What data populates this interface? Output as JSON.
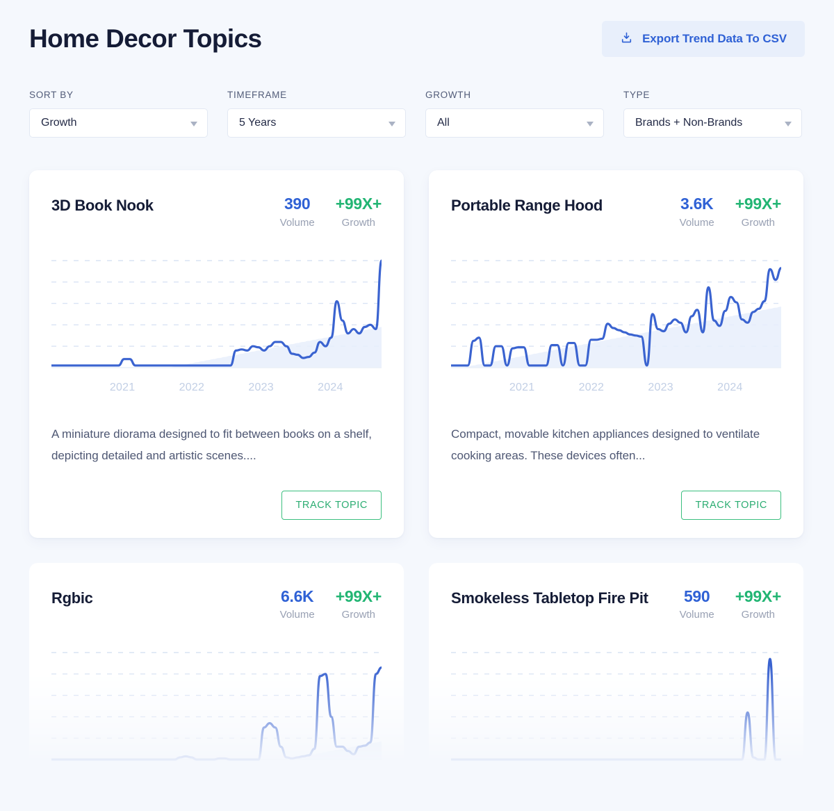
{
  "header": {
    "title": "Home Decor Topics",
    "export_label": "Export Trend Data To CSV",
    "export_icon": "download-icon"
  },
  "filters": [
    {
      "label": "SORT BY",
      "value": "Growth"
    },
    {
      "label": "TIMEFRAME",
      "value": "5 Years"
    },
    {
      "label": "GROWTH",
      "value": "All"
    },
    {
      "label": "TYPE",
      "value": "Brands + Non-Brands"
    }
  ],
  "colors": {
    "page_bg": "#f5f8fd",
    "card_bg": "#ffffff",
    "title": "#151c36",
    "volume": "#2f61d5",
    "growth": "#22b573",
    "line": "#3a63d0",
    "area": "#e8effb",
    "gridline": "#d9e3f4",
    "axis_label": "#c2cfe5",
    "track_border": "#3bbf7f"
  },
  "labels": {
    "volume_caption": "Volume",
    "growth_caption": "Growth",
    "track_label": "TRACK TOPIC"
  },
  "cards": [
    {
      "name": "3D Book Nook",
      "volume": "390",
      "growth": "+99X+",
      "description": "A miniature diorama designed to fit between books on a shelf, depicting detailed and artistic scenes....",
      "truncated": false,
      "chart_data": {
        "type": "line",
        "title": "3D Book Nook search volume trend",
        "xlabel": "",
        "ylabel": "",
        "grid": true,
        "gridlines": 5,
        "xticks": [
          "2021",
          "2022",
          "2023",
          "2024"
        ],
        "xtick_pos": [
          0.215,
          0.425,
          0.635,
          0.845
        ],
        "ylim": [
          0,
          100
        ],
        "x": [
          0,
          1,
          2,
          3,
          4,
          5,
          6,
          7,
          8,
          9,
          10,
          11,
          12,
          13,
          14,
          15,
          16,
          17,
          18,
          19,
          20,
          21,
          22,
          23,
          24,
          25,
          26,
          27,
          28,
          29,
          30,
          31,
          32,
          33,
          34,
          35,
          36,
          37,
          38,
          39,
          40,
          41,
          42,
          43,
          44,
          45,
          46,
          47,
          48,
          49,
          50,
          51,
          52,
          53,
          54,
          55,
          56,
          57,
          58,
          59
        ],
        "values": [
          2,
          2,
          2,
          2,
          2,
          2,
          2,
          2,
          2,
          2,
          2,
          2,
          2,
          8,
          8,
          2,
          2,
          2,
          2,
          2,
          2,
          2,
          2,
          2,
          2,
          2,
          2,
          2,
          2,
          2,
          2,
          2,
          2,
          16,
          17,
          16,
          20,
          19,
          16,
          20,
          24,
          24,
          20,
          13,
          12,
          9,
          10,
          14,
          24,
          20,
          28,
          62,
          44,
          32,
          36,
          32,
          38,
          40,
          36,
          100
        ],
        "area_baseline": [
          0,
          0,
          0,
          0,
          0,
          0,
          0,
          0,
          0,
          0,
          0,
          0,
          0,
          0,
          0,
          0,
          0,
          0,
          0,
          0,
          0,
          0,
          1,
          2,
          3,
          4,
          5,
          6,
          7,
          8,
          9,
          10,
          11,
          12,
          13,
          14,
          15,
          16,
          17,
          18,
          19,
          20,
          21,
          22,
          23,
          24,
          25,
          26,
          27,
          28,
          29,
          30,
          31,
          32,
          33,
          34,
          35,
          36,
          37,
          38
        ]
      }
    },
    {
      "name": "Portable Range Hood",
      "volume": "3.6K",
      "growth": "+99X+",
      "description": "Compact, movable kitchen appliances designed to ventilate cooking areas. These devices often...",
      "truncated": true,
      "chart_data": {
        "type": "line",
        "title": "Portable Range Hood search volume trend",
        "xlabel": "",
        "ylabel": "",
        "grid": true,
        "gridlines": 5,
        "xticks": [
          "2021",
          "2022",
          "2023",
          "2024"
        ],
        "xtick_pos": [
          0.215,
          0.425,
          0.635,
          0.845
        ],
        "ylim": [
          0,
          100
        ],
        "x": [
          0,
          1,
          2,
          3,
          4,
          5,
          6,
          7,
          8,
          9,
          10,
          11,
          12,
          13,
          14,
          15,
          16,
          17,
          18,
          19,
          20,
          21,
          22,
          23,
          24,
          25,
          26,
          27,
          28,
          29,
          30,
          31,
          32,
          33,
          34,
          35,
          36,
          37,
          38,
          39,
          40,
          41,
          42,
          43,
          44,
          45,
          46,
          47,
          48,
          49,
          50,
          51,
          52,
          53,
          54,
          55,
          56,
          57,
          58,
          59
        ],
        "values": [
          2,
          2,
          2,
          2,
          25,
          28,
          2,
          2,
          20,
          20,
          2,
          18,
          19,
          19,
          2,
          2,
          2,
          2,
          21,
          21,
          2,
          23,
          23,
          2,
          2,
          26,
          26,
          27,
          41,
          37,
          35,
          33,
          31,
          30,
          29,
          2,
          50,
          36,
          34,
          41,
          45,
          42,
          33,
          48,
          54,
          33,
          75,
          44,
          39,
          53,
          66,
          61,
          45,
          42,
          52,
          55,
          62,
          92,
          82,
          93
        ],
        "area_baseline": [
          0,
          0,
          0,
          1,
          2,
          3,
          4,
          5,
          6,
          7,
          8,
          9,
          10,
          11,
          12,
          13,
          14,
          15,
          16,
          17,
          18,
          19,
          20,
          21,
          22,
          23,
          24,
          25,
          26,
          27,
          28,
          29,
          30,
          31,
          32,
          33,
          34,
          35,
          36,
          37,
          38,
          39,
          40,
          41,
          42,
          43,
          44,
          45,
          46,
          47,
          48,
          49,
          50,
          51,
          52,
          53,
          54,
          55,
          56,
          57
        ]
      }
    },
    {
      "name": "Rgbic",
      "volume": "6.6K",
      "growth": "+99X+",
      "description": "",
      "truncated": false,
      "chart_data": {
        "type": "line",
        "title": "Rgbic search volume trend",
        "xlabel": "",
        "ylabel": "",
        "grid": true,
        "gridlines": 5,
        "xticks": [],
        "xtick_pos": [],
        "ylim": [
          0,
          100
        ],
        "x": [
          0,
          1,
          2,
          3,
          4,
          5,
          6,
          7,
          8,
          9,
          10,
          11,
          12,
          13,
          14,
          15,
          16,
          17,
          18,
          19,
          20,
          21,
          22,
          23,
          24,
          25,
          26,
          27,
          28,
          29,
          30,
          31,
          32,
          33,
          34,
          35,
          36,
          37,
          38,
          39,
          40,
          41,
          42,
          43,
          44,
          45,
          46,
          47,
          48,
          49,
          50,
          51,
          52,
          53,
          54,
          55,
          56,
          57,
          58,
          59
        ],
        "values": [
          0,
          0,
          0,
          0,
          0,
          0,
          0,
          0,
          0,
          0,
          0,
          0,
          0,
          0,
          0,
          0,
          0,
          0,
          0,
          0,
          0,
          0,
          0,
          2,
          3,
          2,
          0,
          0,
          0,
          0,
          1,
          1,
          0,
          0,
          0,
          0,
          0,
          0,
          30,
          34,
          30,
          12,
          2,
          1,
          2,
          3,
          4,
          10,
          78,
          80,
          40,
          12,
          12,
          8,
          5,
          12,
          13,
          16,
          80,
          86
        ],
        "area_baseline": [
          0,
          0,
          0,
          0,
          0,
          0,
          0,
          0,
          0,
          0,
          0,
          0,
          0,
          0,
          0,
          0,
          0,
          0,
          0,
          0,
          0,
          0,
          0,
          0,
          0,
          0,
          0,
          0,
          0,
          0,
          0,
          0,
          0,
          0,
          0,
          0,
          0,
          0,
          0,
          0,
          0,
          0,
          0,
          1,
          2,
          3,
          4,
          5,
          6,
          7,
          8,
          9,
          10,
          11,
          12,
          13,
          14,
          15,
          16,
          17
        ]
      }
    },
    {
      "name": "Smokeless Tabletop Fire Pit",
      "volume": "590",
      "growth": "+99X+",
      "description": "",
      "truncated": false,
      "chart_data": {
        "type": "line",
        "title": "Smokeless Tabletop Fire Pit search volume trend",
        "xlabel": "",
        "ylabel": "",
        "grid": true,
        "gridlines": 5,
        "xticks": [],
        "xtick_pos": [],
        "ylim": [
          0,
          100
        ],
        "x": [
          0,
          1,
          2,
          3,
          4,
          5,
          6,
          7,
          8,
          9,
          10,
          11,
          12,
          13,
          14,
          15,
          16,
          17,
          18,
          19,
          20,
          21,
          22,
          23,
          24,
          25,
          26,
          27,
          28,
          29,
          30,
          31,
          32,
          33,
          34,
          35,
          36,
          37,
          38,
          39,
          40,
          41,
          42,
          43,
          44,
          45,
          46,
          47,
          48,
          49,
          50,
          51,
          52,
          53,
          54,
          55,
          56,
          57,
          58,
          59
        ],
        "values": [
          0,
          0,
          0,
          0,
          0,
          0,
          0,
          0,
          0,
          0,
          0,
          0,
          0,
          0,
          0,
          0,
          0,
          0,
          0,
          0,
          0,
          0,
          0,
          0,
          0,
          0,
          0,
          0,
          0,
          0,
          0,
          0,
          0,
          0,
          0,
          0,
          0,
          0,
          0,
          0,
          0,
          0,
          0,
          0,
          0,
          0,
          0,
          0,
          0,
          0,
          0,
          0,
          0,
          44,
          2,
          0,
          0,
          94,
          0,
          0
        ],
        "area_baseline": [
          0,
          0,
          0,
          0,
          0,
          0,
          0,
          0,
          0,
          0,
          0,
          0,
          0,
          0,
          0,
          0,
          0,
          0,
          0,
          0,
          0,
          0,
          0,
          0,
          0,
          0,
          0,
          0,
          0,
          0,
          0,
          0,
          0,
          0,
          0,
          0,
          0,
          0,
          0,
          0,
          0,
          0,
          0,
          0,
          0,
          0,
          0,
          0,
          0,
          0,
          0,
          0,
          0,
          0,
          0,
          0,
          0,
          0,
          0,
          0
        ]
      }
    }
  ]
}
